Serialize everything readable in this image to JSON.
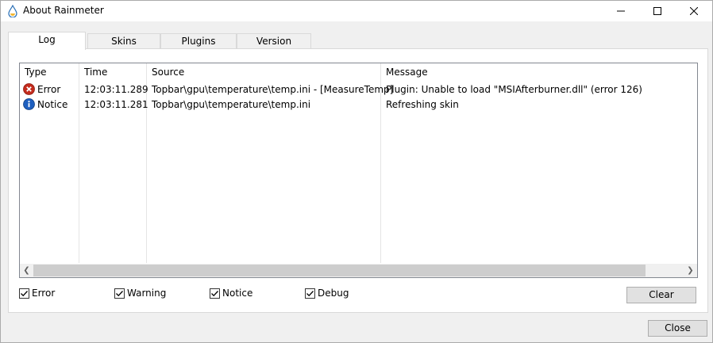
{
  "window": {
    "title": "About Rainmeter"
  },
  "tabs": [
    {
      "label": "Log"
    },
    {
      "label": "Skins"
    },
    {
      "label": "Plugins"
    },
    {
      "label": "Version"
    }
  ],
  "log": {
    "columns": [
      "Type",
      "Time",
      "Source",
      "Message"
    ],
    "rows": [
      {
        "type": "Error",
        "time": "12:03:11.289",
        "source": "Topbar\\gpu\\temperature\\temp.ini - [MeasureTemp]",
        "message": "Plugin: Unable to load \"MSIAfterburner.dll\" (error 126)"
      },
      {
        "type": "Notice",
        "time": "12:03:11.281",
        "source": "Topbar\\gpu\\temperature\\temp.ini",
        "message": "Refreshing skin"
      }
    ]
  },
  "filters": [
    {
      "label": "Error",
      "checked": true
    },
    {
      "label": "Warning",
      "checked": true
    },
    {
      "label": "Notice",
      "checked": true
    },
    {
      "label": "Debug",
      "checked": true
    }
  ],
  "buttons": {
    "clear": "Clear",
    "close": "Close"
  },
  "colors": {
    "error": "#c42b1c",
    "notice": "#1e5fbf"
  }
}
